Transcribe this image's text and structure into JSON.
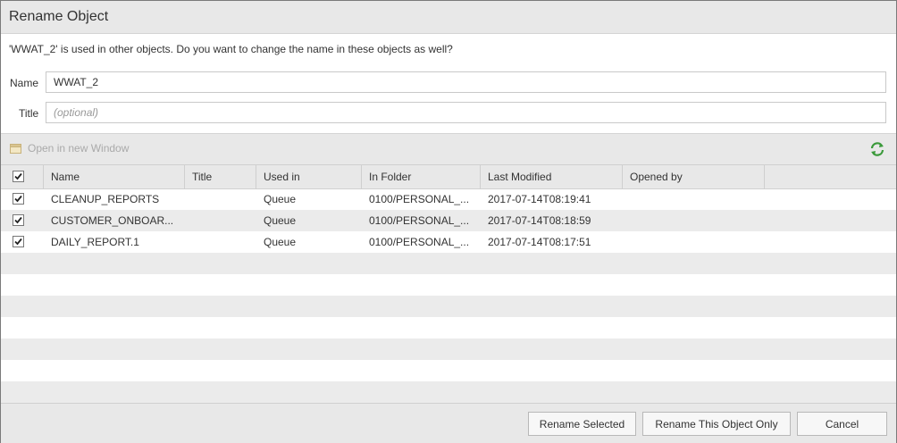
{
  "dialog": {
    "title": "Rename Object",
    "message": "'WWAT_2' is used in other objects. Do you want to change the name in these objects as well?"
  },
  "form": {
    "name_label": "Name",
    "name_value": "WWAT_2",
    "title_label": "Title",
    "title_placeholder": "(optional)"
  },
  "toolbar": {
    "open_window_label": "Open in new Window",
    "open_window_icon": "window-icon",
    "refresh_icon": "refresh-icon"
  },
  "grid": {
    "columns": [
      "Name",
      "Title",
      "Used in",
      "In Folder",
      "Last Modified",
      "Opened by"
    ],
    "rows": [
      {
        "name": "CLEANUP_REPORTS",
        "title": "",
        "used_in": "Queue",
        "folder": "0100/PERSONAL_...",
        "modified": "2017-07-14T08:19:41",
        "opened_by": ""
      },
      {
        "name": "CUSTOMER_ONBOAR...",
        "title": "",
        "used_in": "Queue",
        "folder": "0100/PERSONAL_...",
        "modified": "2017-07-14T08:18:59",
        "opened_by": ""
      },
      {
        "name": "DAILY_REPORT.1",
        "title": "",
        "used_in": "Queue",
        "folder": "0100/PERSONAL_...",
        "modified": "2017-07-14T08:17:51",
        "opened_by": ""
      }
    ]
  },
  "buttons": {
    "rename_selected": "Rename Selected",
    "rename_this_only": "Rename This Object Only",
    "cancel": "Cancel"
  },
  "colors": {
    "accent_green": "#3a9a3a",
    "header_bg": "#e8e8e8",
    "alt_row_bg": "#ebebeb"
  }
}
